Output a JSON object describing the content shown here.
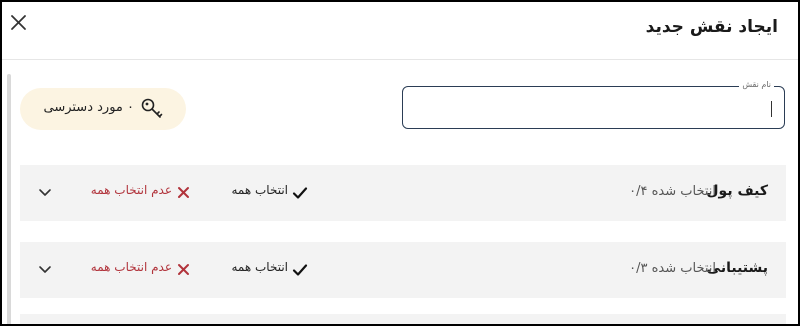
{
  "dialog": {
    "title": "ایجاد نقش جدید",
    "close_icon": "close-icon"
  },
  "role_name_field": {
    "label": "نام نقش",
    "value": "",
    "placeholder": ""
  },
  "access_pill": {
    "label": "۰ مورد دسترسی",
    "icon": "key-icon",
    "background": "#fcf4e2"
  },
  "sections": [
    {
      "title": "کیف پول",
      "selected_count": "انتخاب شده ۰/۴",
      "select_all_label": "انتخاب همه",
      "deselect_all_label": "عدم انتخاب همه"
    },
    {
      "title": "پشتیبانی",
      "selected_count": "انتخاب شده ۰/۳",
      "select_all_label": "انتخاب همه",
      "deselect_all_label": "عدم انتخاب همه"
    }
  ],
  "colors": {
    "field_border": "#2b3d55",
    "danger": "#b1333b",
    "section_bg": "#f3f3f3"
  }
}
